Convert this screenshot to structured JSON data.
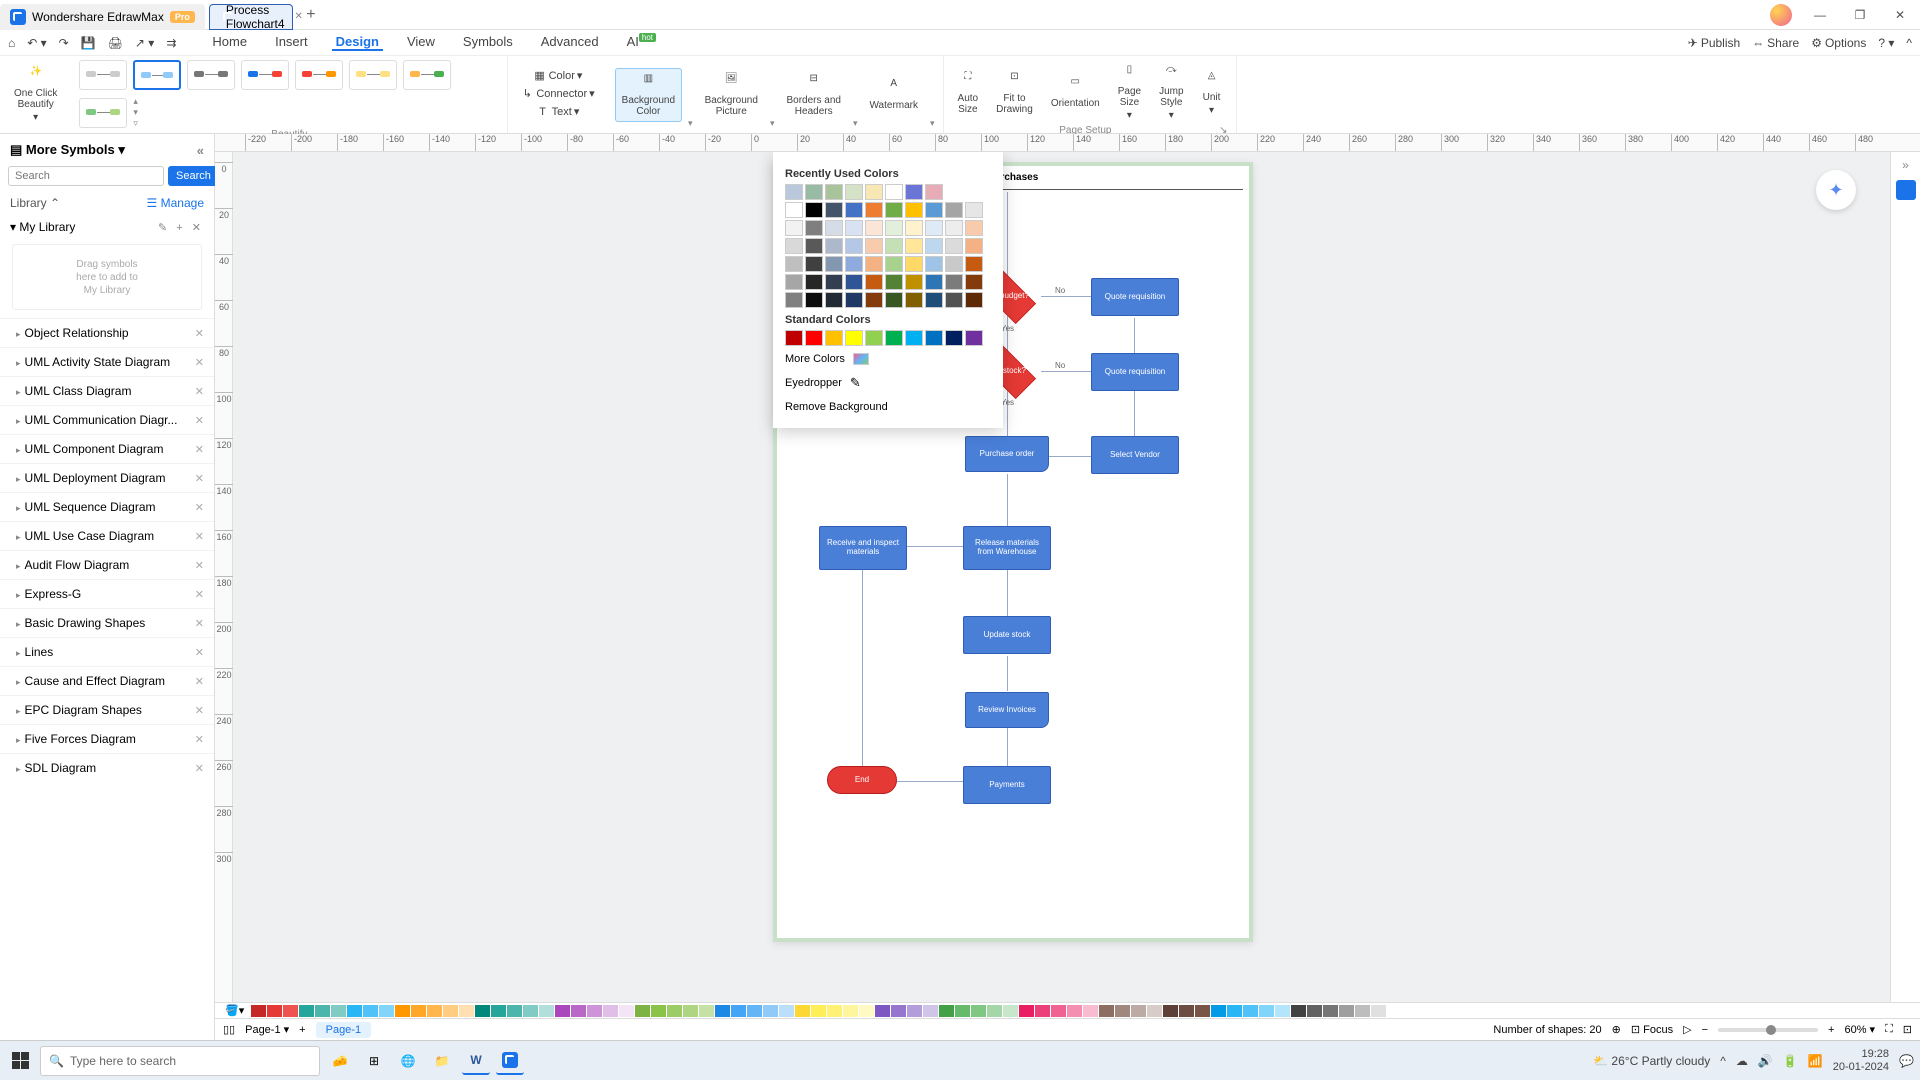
{
  "titlebar": {
    "app_name": "Wondershare EdrawMax",
    "pro": "Pro",
    "doc_name": "Process Flowchart4"
  },
  "quickbar_right": {
    "publish": "Publish",
    "share": "Share",
    "options": "Options"
  },
  "menu": {
    "items": [
      "Home",
      "Insert",
      "Design",
      "View",
      "Symbols",
      "Advanced",
      "AI"
    ],
    "hot": "hot"
  },
  "ribbon": {
    "oneclick": "One Click\nBeautify",
    "beautify": "Beautify",
    "color": "Color",
    "connector": "Connector",
    "text": "Text",
    "bgcolor": "Background\nColor",
    "bgpic": "Background\nPicture",
    "borders": "Borders and\nHeaders",
    "watermark": "Watermark",
    "autosize": "Auto\nSize",
    "fit": "Fit to\nDrawing",
    "orientation": "Orientation",
    "pagesize": "Page\nSize",
    "jumpstyle": "Jump\nStyle",
    "unit": "Unit",
    "pagesetup": "Page Setup"
  },
  "color_popup": {
    "recent": "Recently Used Colors",
    "standard": "Standard Colors",
    "more": "More Colors",
    "eyedropper": "Eyedropper",
    "remove": "Remove Background",
    "recent_colors": [
      "#b9c8da",
      "#99bba3",
      "#a9c49a",
      "#d6e2c8",
      "#f6e7b5",
      "#fff",
      "#6b75d7",
      "#e6adb8"
    ],
    "theme_grid": [
      [
        "#ffffff",
        "#000000",
        "#44546a",
        "#4472c4",
        "#ed7d31",
        "#70ad47",
        "#ffc000",
        "#5b9bd5",
        "#a5a5a5",
        "#e7e6e6"
      ],
      [
        "#f2f2f2",
        "#7f7f7f",
        "#d6dce5",
        "#d9e2f3",
        "#fbe5d6",
        "#e2efda",
        "#fff2cc",
        "#deebf7",
        "#ededed",
        "#f8cbad"
      ],
      [
        "#d9d9d9",
        "#595959",
        "#adb9ca",
        "#b4c7e7",
        "#f8cbad",
        "#c5e0b4",
        "#ffe699",
        "#bdd7ee",
        "#dbdbdb",
        "#f4b183"
      ],
      [
        "#bfbfbf",
        "#404040",
        "#8497b0",
        "#8faadc",
        "#f4b183",
        "#a9d18e",
        "#ffd966",
        "#9dc3e6",
        "#c9c9c9",
        "#c55a11"
      ],
      [
        "#a6a6a6",
        "#262626",
        "#333f50",
        "#2f5597",
        "#c55a11",
        "#548235",
        "#bf9000",
        "#2e75b6",
        "#7b7b7b",
        "#843c0c"
      ],
      [
        "#808080",
        "#0d0d0d",
        "#222a35",
        "#1f3864",
        "#843c0c",
        "#385723",
        "#806000",
        "#1f4e79",
        "#525252",
        "#5e2a06"
      ]
    ],
    "standard_colors": [
      "#c00000",
      "#ff0000",
      "#ffc000",
      "#ffff00",
      "#92d050",
      "#00b050",
      "#00b0f0",
      "#0070c0",
      "#002060",
      "#7030a0"
    ]
  },
  "sidebar": {
    "title": "More Symbols",
    "search_ph": "Search",
    "search_btn": "Search",
    "library": "Library",
    "manage": "Manage",
    "mylib": "My Library",
    "drop": "Drag symbols\nhere to add to\nMy Library",
    "cats": [
      "Object Relationship",
      "UML Activity State Diagram",
      "UML Class Diagram",
      "UML Communication Diagr...",
      "UML Component Diagram",
      "UML Deployment Diagram",
      "UML Sequence Diagram",
      "UML Use Case Diagram",
      "Audit Flow Diagram",
      "Express-G",
      "Basic Drawing Shapes",
      "Lines",
      "Cause and Effect Diagram",
      "EPC Diagram Shapes",
      "Five Forces Diagram",
      "SDL Diagram"
    ]
  },
  "ruler_h": [
    "-220",
    "-200",
    "-180",
    "-160",
    "-140",
    "-120",
    "-100",
    "-80",
    "-60",
    "-40",
    "-20",
    "0",
    "20",
    "40",
    "60",
    "80",
    "100",
    "120",
    "140",
    "160",
    "180",
    "200",
    "220",
    "240",
    "260",
    "280",
    "300",
    "320",
    "340",
    "360",
    "380",
    "400",
    "420",
    "440",
    "460",
    "480"
  ],
  "ruler_v": [
    "0",
    "20",
    "40",
    "60",
    "80",
    "100",
    "120",
    "140",
    "160",
    "180",
    "200",
    "220",
    "240",
    "260",
    "280",
    "300"
  ],
  "flow": {
    "title": "Purchases",
    "onbudget": "On budget?",
    "onstock": "On stock?",
    "quote1": "Quote\nrequisition",
    "quote2": "Quote\nrequisition",
    "porder": "Purchase\norder",
    "vendor": "Select\nVendor",
    "receive": "Receive and\ninspect\nmaterials",
    "release": "Release\nmaterials from\nWarehouse",
    "update": "Update stock",
    "review": "Review\nInvoices",
    "payments": "Payments",
    "end": "End",
    "yes": "Yes",
    "no": "No"
  },
  "strip_colors": [
    "#c62828",
    "#e53935",
    "#ef5350",
    "#26a69a",
    "#4db6ac",
    "#80cbc4",
    "#29b6f6",
    "#4fc3f7",
    "#81d4fa",
    "#ff9800",
    "#ffa726",
    "#ffb74d",
    "#ffcc80",
    "#ffe0b2",
    "#00897b",
    "#26a69a",
    "#4db6ac",
    "#80cbc4",
    "#b2dfdb",
    "#ab47bc",
    "#ba68c8",
    "#ce93d8",
    "#e1bee7",
    "#f3e5f5",
    "#7cb342",
    "#8bc34a",
    "#9ccc65",
    "#aed581",
    "#c5e1a5",
    "#1e88e5",
    "#42a5f5",
    "#64b5f6",
    "#90caf9",
    "#bbdefb",
    "#fdd835",
    "#ffee58",
    "#fff176",
    "#fff59d",
    "#fff9c4",
    "#7e57c2",
    "#9575cd",
    "#b39ddb",
    "#d1c4e9",
    "#43a047",
    "#66bb6a",
    "#81c784",
    "#a5d6a7",
    "#c8e6c9",
    "#e91e63",
    "#ec407a",
    "#f06292",
    "#f48fb1",
    "#f8bbd0",
    "#8d6e63",
    "#a1887f",
    "#bcaaa4",
    "#d7ccc8",
    "#5d4037",
    "#6d4c41",
    "#795548",
    "#039be5",
    "#29b6f6",
    "#4fc3f7",
    "#81d4fa",
    "#b3e5fc",
    "#424242",
    "#616161",
    "#757575",
    "#9e9e9e",
    "#bdbdbd",
    "#e0e0e0",
    "#ffffff"
  ],
  "status": {
    "pagesel": "Page-1",
    "pagetab": "Page-1",
    "shapes": "Number of shapes: 20",
    "focus": "Focus",
    "zoom": "60%"
  },
  "taskbar": {
    "search_ph": "Type here to search",
    "weather": "26°C  Partly cloudy",
    "time": "19:28",
    "date": "20-01-2024"
  }
}
